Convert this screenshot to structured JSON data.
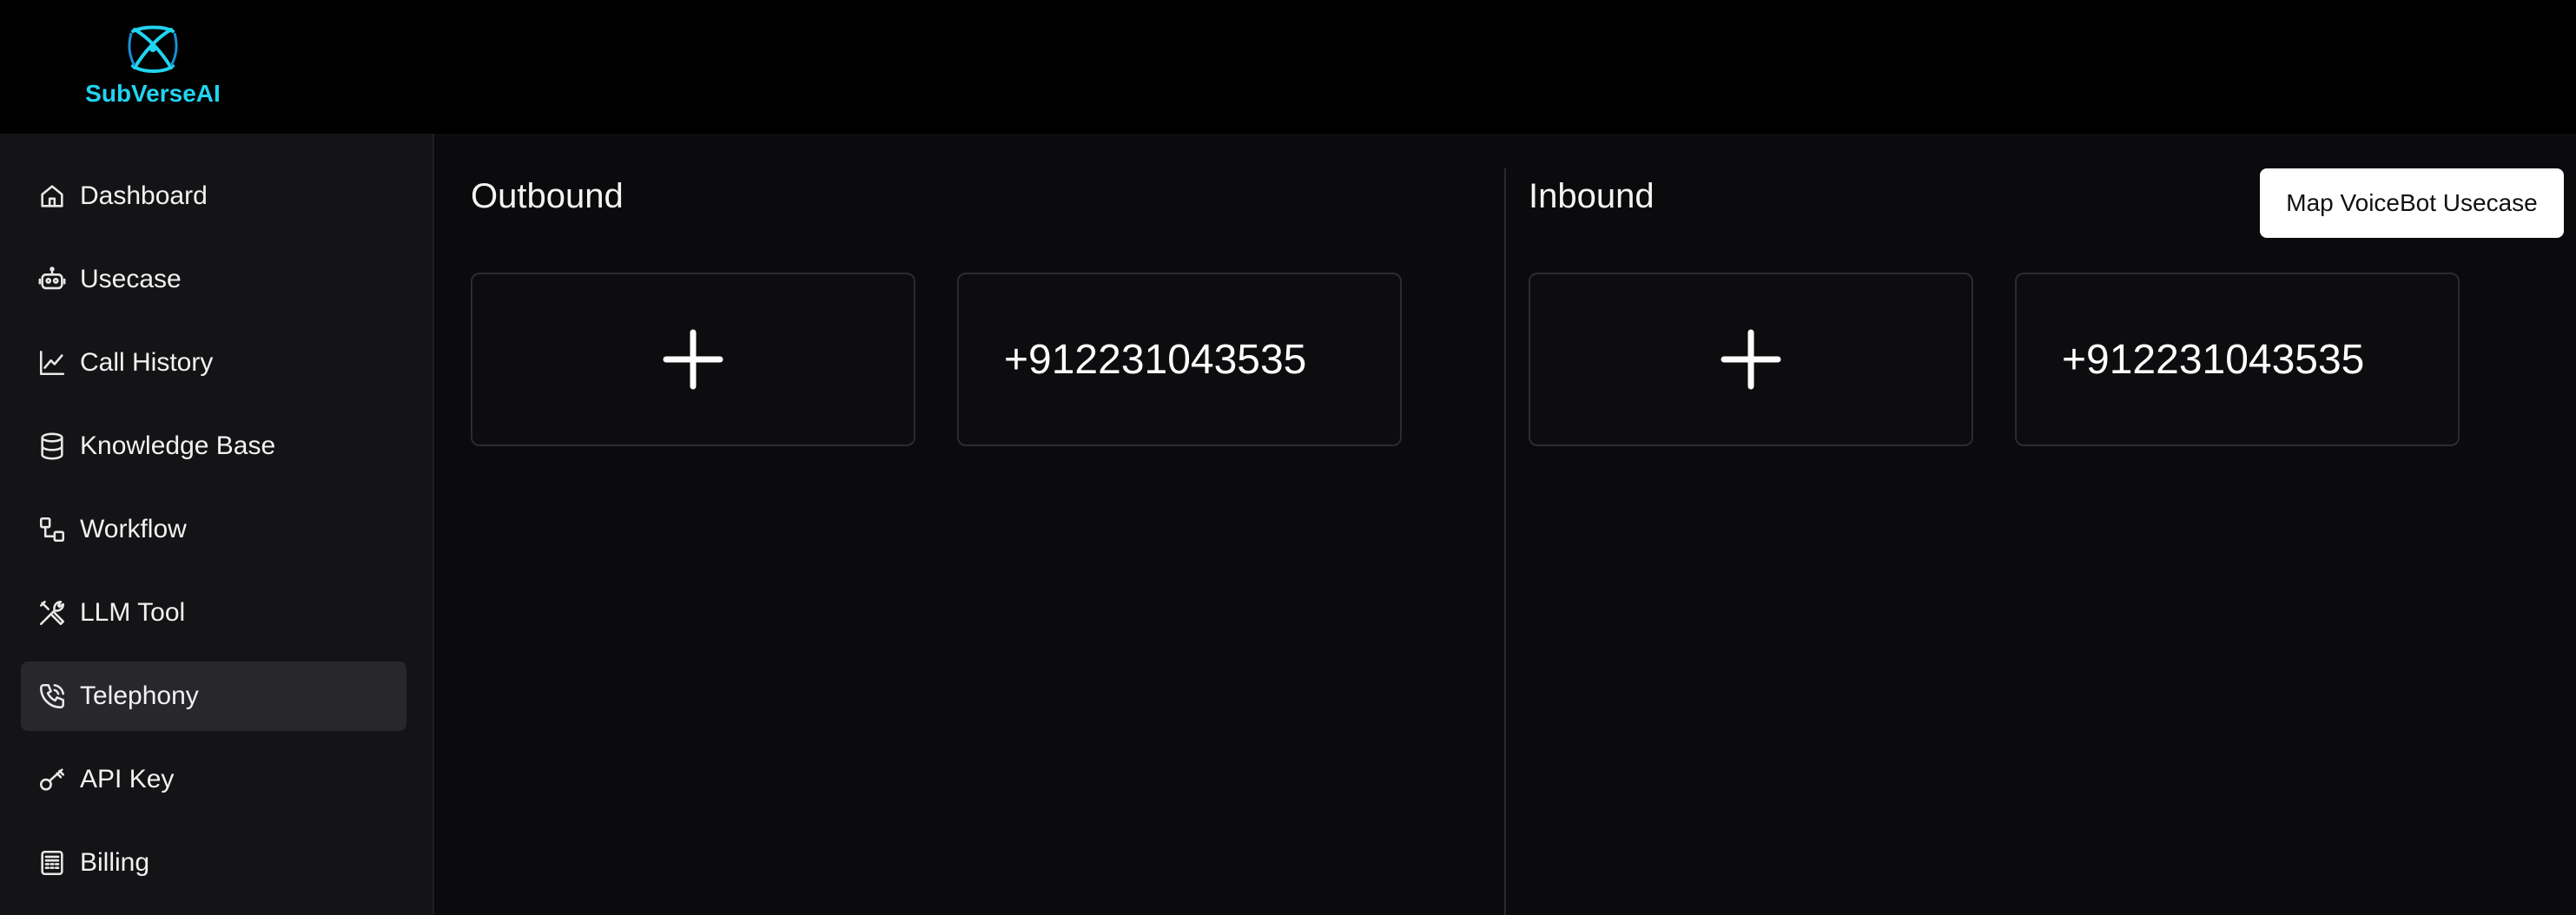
{
  "brand": {
    "name": "SubVerseAI",
    "logo_icon": "atom-icon",
    "accent": "#21d4f0"
  },
  "sidebar": {
    "items": [
      {
        "label": "Dashboard",
        "icon": "home-icon",
        "active": false
      },
      {
        "label": "Usecase",
        "icon": "robot-icon",
        "active": false
      },
      {
        "label": "Call History",
        "icon": "line-chart-icon",
        "active": false
      },
      {
        "label": "Knowledge Base",
        "icon": "database-icon",
        "active": false
      },
      {
        "label": "Workflow",
        "icon": "workflow-icon",
        "active": false
      },
      {
        "label": "LLM Tool",
        "icon": "tools-icon",
        "active": false
      },
      {
        "label": "Telephony",
        "icon": "phone-icon",
        "active": true
      },
      {
        "label": "API Key",
        "icon": "key-icon",
        "active": false
      },
      {
        "label": "Billing",
        "icon": "billing-icon",
        "active": false
      }
    ]
  },
  "outbound": {
    "title": "Outbound",
    "add_icon": "plus-icon",
    "number": "+912231043535"
  },
  "inbound": {
    "title": "Inbound",
    "add_icon": "plus-icon",
    "number": "+912231043535"
  },
  "actions": {
    "map_label": "Map VoiceBot Usecase"
  }
}
